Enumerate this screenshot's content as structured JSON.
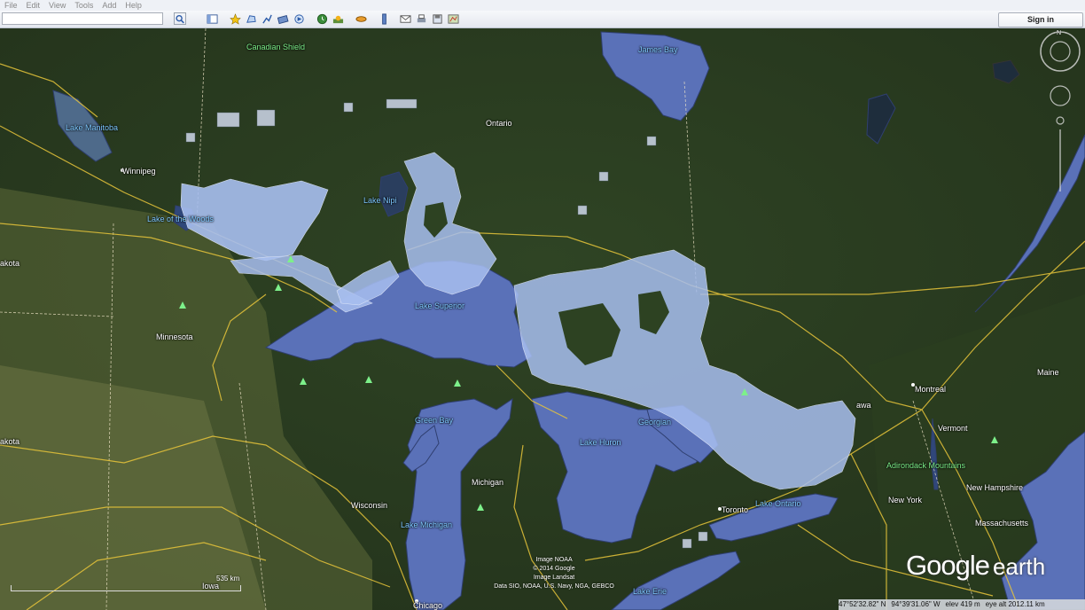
{
  "menu": [
    "File",
    "Edit",
    "View",
    "Tools",
    "Add",
    "Help"
  ],
  "toolbar": {
    "search_placeholder": "",
    "sign_in_label": "Sign in",
    "icons": [
      "search-icon",
      "sidebar-icon",
      "placemark-icon",
      "polygon-icon",
      "path-icon",
      "overlay-icon",
      "tour-icon",
      "history-icon",
      "sun-icon",
      "planets-icon",
      "ruler-icon",
      "email-icon",
      "print-icon",
      "save-image-icon",
      "maps-icon"
    ]
  },
  "labels": {
    "canadian_shield": "Canadian Shield",
    "james_bay": "James Bay",
    "ontario": "Ontario",
    "lake_manitoba": "Lake Manitoba",
    "winnipeg": "Winnipeg",
    "lake_woods": "Lake of the Woods",
    "lake_nipigon": "Lake Nipi",
    "dakota_top": "akota",
    "minnesota": "Minnesota",
    "lake_superior": "Lake Superior",
    "green_bay": "Green Bay",
    "georgian": "Georgian",
    "lake_huron": "Lake Huron",
    "michigan": "Michigan",
    "wisconsin": "Wisconsin",
    "lake_michigan": "Lake Michigan",
    "toronto": "Toronto",
    "lake_ontario": "Lake Ontario",
    "montreal": "Montreal",
    "ottawa": "awa",
    "maine": "Maine",
    "vermont": "Vermont",
    "adirondack": "Adirondack Mountains",
    "new_york": "New York",
    "new_hampshire": "New Hampshire",
    "massachusetts": "Massachusetts",
    "dakota_bottom": "akota",
    "iowa": "Iowa",
    "chicago": "Chicago",
    "lake_erie": "Lake Erie"
  },
  "scale_label": "535 km",
  "attribution": [
    "Image NOAA",
    "© 2014 Google",
    "Image Landsat",
    "Data SIO, NOAA, U.S. Navy, NGA, GEBCO"
  ],
  "logo": {
    "google": "Google",
    "earth": "earth"
  },
  "status": {
    "lat": "47°52'32.82\" N",
    "lon": "94°39'31.06\" W",
    "elev": "elev   419 m",
    "eye_alt": "eye alt 2012.11 km"
  },
  "compass_letter": "N",
  "colors": {
    "water": "#5a71b8",
    "land": "#33452a",
    "roads": "#e8c53a",
    "markers": "#a8bff0"
  }
}
